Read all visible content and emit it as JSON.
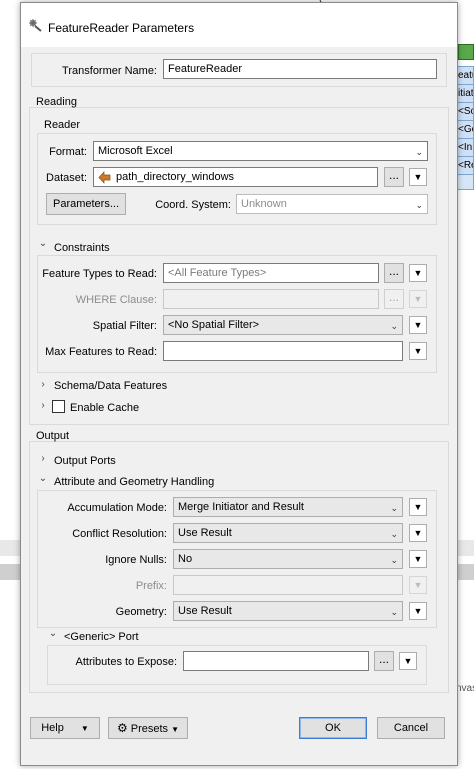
{
  "background": {
    "blue_panel_rows": [
      "eatu",
      "itiat",
      "<Sc",
      "<Ge",
      "<In",
      "<Re"
    ],
    "canvas_text": "nvas"
  },
  "dialog": {
    "title": "FeatureReader Parameters",
    "close_glyph": "✕",
    "transformer_name_label": "Transformer Name:",
    "transformer_name_value": "FeatureReader",
    "reading": {
      "title": "Reading",
      "reader": {
        "title": "Reader",
        "format_label": "Format:",
        "format_value": "Microsoft Excel",
        "dataset_label": "Dataset:",
        "dataset_value": "path_directory_windows",
        "parameters_button": "Parameters...",
        "coord_system_label": "Coord. System:",
        "coord_system_value": "Unknown"
      },
      "constraints": {
        "title": "Constraints",
        "feature_types_label": "Feature Types to Read:",
        "feature_types_placeholder": "<All Feature Types>",
        "where_clause_label": "WHERE Clause:",
        "spatial_filter_label": "Spatial Filter:",
        "spatial_filter_value": "<No Spatial Filter>",
        "max_features_label": "Max Features to Read:",
        "max_features_value": ""
      },
      "schema_data_features": "Schema/Data Features",
      "enable_cache": "Enable Cache"
    },
    "output": {
      "title": "Output",
      "output_ports": "Output Ports",
      "attr_geom_handling": {
        "title": "Attribute and Geometry Handling",
        "accumulation_mode_label": "Accumulation Mode:",
        "accumulation_mode_value": "Merge Initiator and Result",
        "conflict_resolution_label": "Conflict Resolution:",
        "conflict_resolution_value": "Use Result",
        "ignore_nulls_label": "Ignore Nulls:",
        "ignore_nulls_value": "No",
        "prefix_label": "Prefix:",
        "prefix_value": "",
        "geometry_label": "Geometry:",
        "geometry_value": "Use Result"
      },
      "generic_port": {
        "title": "<Generic> Port",
        "attributes_to_expose_label": "Attributes to Expose:",
        "attributes_to_expose_value": ""
      }
    },
    "footer": {
      "help_label": "Help",
      "presets_label": "Presets",
      "ok_label": "OK",
      "cancel_label": "Cancel"
    },
    "glyphs": {
      "ellipsis": "...",
      "dropdown": "▼",
      "chevron_down": "⌄",
      "expanded": "⌄",
      "collapsed": "›"
    },
    "colors": {
      "accent": "#3a7bd5",
      "dialog_bg": "#f0f0f0"
    }
  }
}
